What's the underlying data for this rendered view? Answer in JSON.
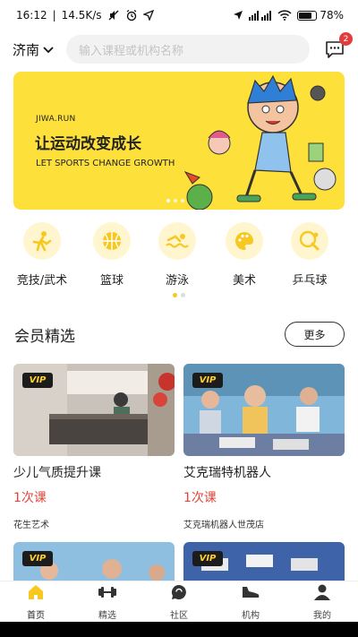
{
  "status_bar": {
    "time": "16:12",
    "speed": "14.5K/s",
    "battery": "78%"
  },
  "header": {
    "city": "济南",
    "search_placeholder": "输入课程或机构名称",
    "message_badge": "2"
  },
  "banner": {
    "subtitle": "JIWA.RUN",
    "title": "让运动改变成长",
    "tagline": "LET SPORTS CHANGE GROWTH",
    "slides": 3,
    "active_slide": 1
  },
  "categories": [
    {
      "label": "竞技/武术",
      "icon": "martial-arts-icon"
    },
    {
      "label": "篮球",
      "icon": "basketball-icon"
    },
    {
      "label": "游泳",
      "icon": "swimming-icon"
    },
    {
      "label": "美术",
      "icon": "palette-icon"
    },
    {
      "label": "乒乓球",
      "icon": "ping-pong-icon"
    }
  ],
  "section": {
    "title": "会员精选",
    "more_label": "更多"
  },
  "cards": [
    {
      "title": "少儿气质提升课",
      "price": "1次课",
      "org": "花生艺术",
      "badge": "VIP"
    },
    {
      "title": "艾克瑞特机器人",
      "price": "1次课",
      "org": "艾克瑞机器人世茂店",
      "badge": "VIP"
    },
    {
      "title": "",
      "price": "",
      "org": "",
      "badge": "VIP"
    },
    {
      "title": "",
      "price": "",
      "org": "",
      "badge": "VIP"
    }
  ],
  "nav": [
    {
      "label": "首页",
      "icon": "home-icon",
      "active": true
    },
    {
      "label": "精选",
      "icon": "dumbbell-icon",
      "active": false
    },
    {
      "label": "社区",
      "icon": "chat-bubble-icon",
      "active": false
    },
    {
      "label": "机构",
      "icon": "shoe-icon",
      "active": false
    },
    {
      "label": "我的",
      "icon": "user-icon",
      "active": false
    }
  ],
  "colors": {
    "accent": "#f7c81f",
    "banner_bg": "#fde13a",
    "price": "#e2453a",
    "badge": "#e23c3c"
  }
}
